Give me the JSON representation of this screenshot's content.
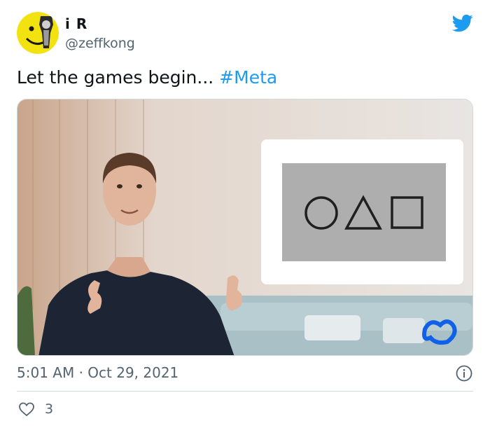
{
  "tweet": {
    "display_name": "i R",
    "handle": "@zeffkong",
    "text": "Let the games begin... ",
    "hashtag": "#Meta",
    "timestamp": "5:01 AM · Oct 29, 2021",
    "like_count": "3"
  },
  "colors": {
    "brand_blue": "#1d9bf0",
    "secondary_text": "#536471",
    "divider": "#cfd9de"
  },
  "icons": {
    "logo": "twitter-bird-icon",
    "info": "info-circle-icon",
    "like": "heart-outline-icon",
    "brand": "meta-infinity-logo"
  }
}
